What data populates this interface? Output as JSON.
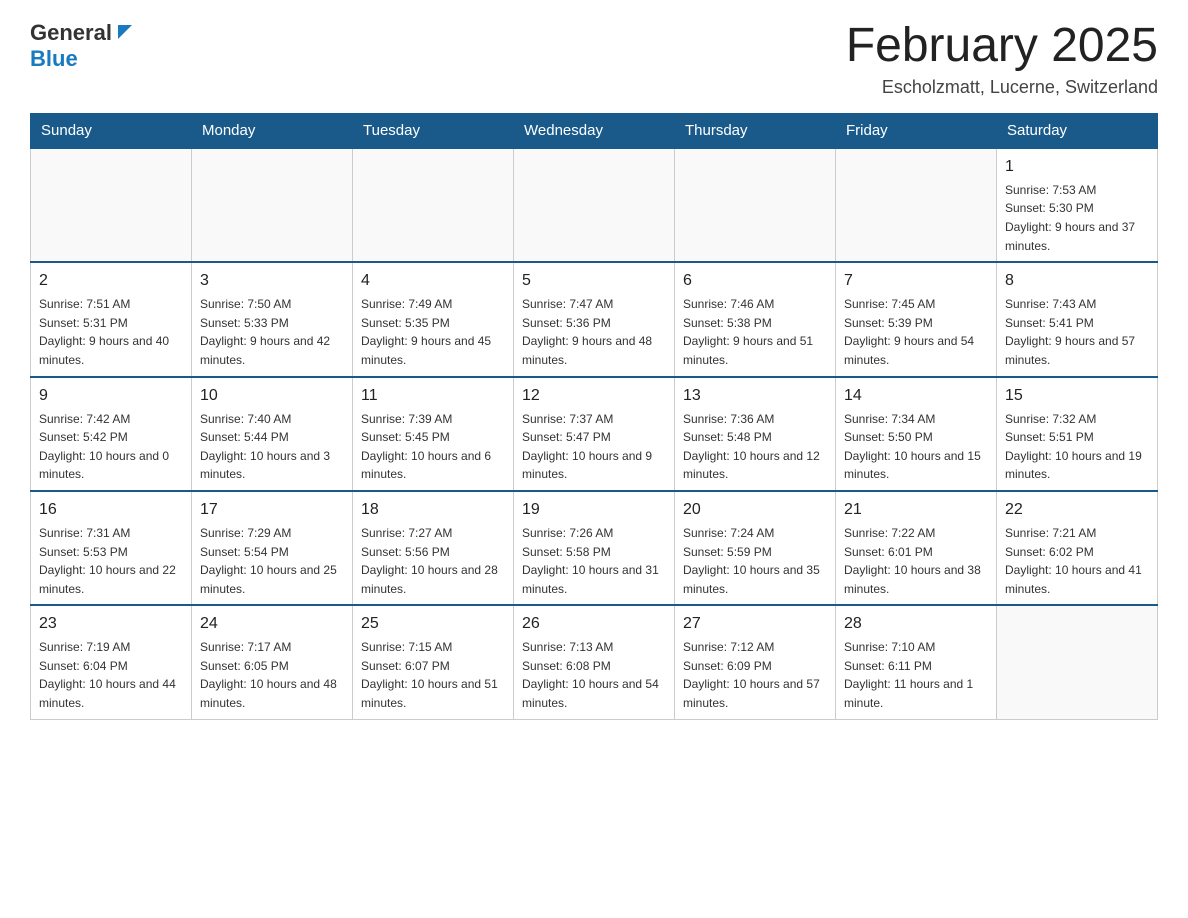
{
  "header": {
    "logo_general": "General",
    "logo_blue": "Blue",
    "title": "February 2025",
    "location": "Escholzmatt, Lucerne, Switzerland"
  },
  "days_of_week": [
    "Sunday",
    "Monday",
    "Tuesday",
    "Wednesday",
    "Thursday",
    "Friday",
    "Saturday"
  ],
  "weeks": [
    {
      "days": [
        {
          "number": "",
          "info": ""
        },
        {
          "number": "",
          "info": ""
        },
        {
          "number": "",
          "info": ""
        },
        {
          "number": "",
          "info": ""
        },
        {
          "number": "",
          "info": ""
        },
        {
          "number": "",
          "info": ""
        },
        {
          "number": "1",
          "info": "Sunrise: 7:53 AM\nSunset: 5:30 PM\nDaylight: 9 hours and 37 minutes."
        }
      ]
    },
    {
      "days": [
        {
          "number": "2",
          "info": "Sunrise: 7:51 AM\nSunset: 5:31 PM\nDaylight: 9 hours and 40 minutes."
        },
        {
          "number": "3",
          "info": "Sunrise: 7:50 AM\nSunset: 5:33 PM\nDaylight: 9 hours and 42 minutes."
        },
        {
          "number": "4",
          "info": "Sunrise: 7:49 AM\nSunset: 5:35 PM\nDaylight: 9 hours and 45 minutes."
        },
        {
          "number": "5",
          "info": "Sunrise: 7:47 AM\nSunset: 5:36 PM\nDaylight: 9 hours and 48 minutes."
        },
        {
          "number": "6",
          "info": "Sunrise: 7:46 AM\nSunset: 5:38 PM\nDaylight: 9 hours and 51 minutes."
        },
        {
          "number": "7",
          "info": "Sunrise: 7:45 AM\nSunset: 5:39 PM\nDaylight: 9 hours and 54 minutes."
        },
        {
          "number": "8",
          "info": "Sunrise: 7:43 AM\nSunset: 5:41 PM\nDaylight: 9 hours and 57 minutes."
        }
      ]
    },
    {
      "days": [
        {
          "number": "9",
          "info": "Sunrise: 7:42 AM\nSunset: 5:42 PM\nDaylight: 10 hours and 0 minutes."
        },
        {
          "number": "10",
          "info": "Sunrise: 7:40 AM\nSunset: 5:44 PM\nDaylight: 10 hours and 3 minutes."
        },
        {
          "number": "11",
          "info": "Sunrise: 7:39 AM\nSunset: 5:45 PM\nDaylight: 10 hours and 6 minutes."
        },
        {
          "number": "12",
          "info": "Sunrise: 7:37 AM\nSunset: 5:47 PM\nDaylight: 10 hours and 9 minutes."
        },
        {
          "number": "13",
          "info": "Sunrise: 7:36 AM\nSunset: 5:48 PM\nDaylight: 10 hours and 12 minutes."
        },
        {
          "number": "14",
          "info": "Sunrise: 7:34 AM\nSunset: 5:50 PM\nDaylight: 10 hours and 15 minutes."
        },
        {
          "number": "15",
          "info": "Sunrise: 7:32 AM\nSunset: 5:51 PM\nDaylight: 10 hours and 19 minutes."
        }
      ]
    },
    {
      "days": [
        {
          "number": "16",
          "info": "Sunrise: 7:31 AM\nSunset: 5:53 PM\nDaylight: 10 hours and 22 minutes."
        },
        {
          "number": "17",
          "info": "Sunrise: 7:29 AM\nSunset: 5:54 PM\nDaylight: 10 hours and 25 minutes."
        },
        {
          "number": "18",
          "info": "Sunrise: 7:27 AM\nSunset: 5:56 PM\nDaylight: 10 hours and 28 minutes."
        },
        {
          "number": "19",
          "info": "Sunrise: 7:26 AM\nSunset: 5:58 PM\nDaylight: 10 hours and 31 minutes."
        },
        {
          "number": "20",
          "info": "Sunrise: 7:24 AM\nSunset: 5:59 PM\nDaylight: 10 hours and 35 minutes."
        },
        {
          "number": "21",
          "info": "Sunrise: 7:22 AM\nSunset: 6:01 PM\nDaylight: 10 hours and 38 minutes."
        },
        {
          "number": "22",
          "info": "Sunrise: 7:21 AM\nSunset: 6:02 PM\nDaylight: 10 hours and 41 minutes."
        }
      ]
    },
    {
      "days": [
        {
          "number": "23",
          "info": "Sunrise: 7:19 AM\nSunset: 6:04 PM\nDaylight: 10 hours and 44 minutes."
        },
        {
          "number": "24",
          "info": "Sunrise: 7:17 AM\nSunset: 6:05 PM\nDaylight: 10 hours and 48 minutes."
        },
        {
          "number": "25",
          "info": "Sunrise: 7:15 AM\nSunset: 6:07 PM\nDaylight: 10 hours and 51 minutes."
        },
        {
          "number": "26",
          "info": "Sunrise: 7:13 AM\nSunset: 6:08 PM\nDaylight: 10 hours and 54 minutes."
        },
        {
          "number": "27",
          "info": "Sunrise: 7:12 AM\nSunset: 6:09 PM\nDaylight: 10 hours and 57 minutes."
        },
        {
          "number": "28",
          "info": "Sunrise: 7:10 AM\nSunset: 6:11 PM\nDaylight: 11 hours and 1 minute."
        },
        {
          "number": "",
          "info": ""
        }
      ]
    }
  ]
}
